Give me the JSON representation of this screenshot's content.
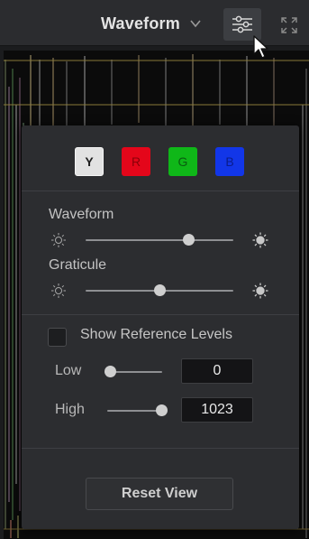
{
  "topbar": {
    "view_mode": "Waveform",
    "icons": {
      "dropdown": "chevron-down-icon",
      "settings": "sliders-icon",
      "expand": "expand-icon",
      "cursor": "mouse-pointer-icon"
    }
  },
  "channels": [
    {
      "label": "Y",
      "color": "#e2e2e2",
      "active": true
    },
    {
      "label": "R",
      "color": "#e4061a",
      "active": false
    },
    {
      "label": "G",
      "color": "#0fb718",
      "active": false
    },
    {
      "label": "B",
      "color": "#1236e8",
      "active": false
    }
  ],
  "brightness": {
    "waveform": {
      "label": "Waveform",
      "level": 0.7
    },
    "graticule": {
      "label": "Graticule",
      "level": 0.5
    }
  },
  "reference_levels": {
    "label": "Show Reference Levels",
    "checked": false,
    "low": {
      "label": "Low",
      "value": "0",
      "slider_level": 0.0
    },
    "high": {
      "label": "High",
      "value": "1023",
      "slider_level": 1.0
    }
  },
  "reset_button": "Reset View"
}
